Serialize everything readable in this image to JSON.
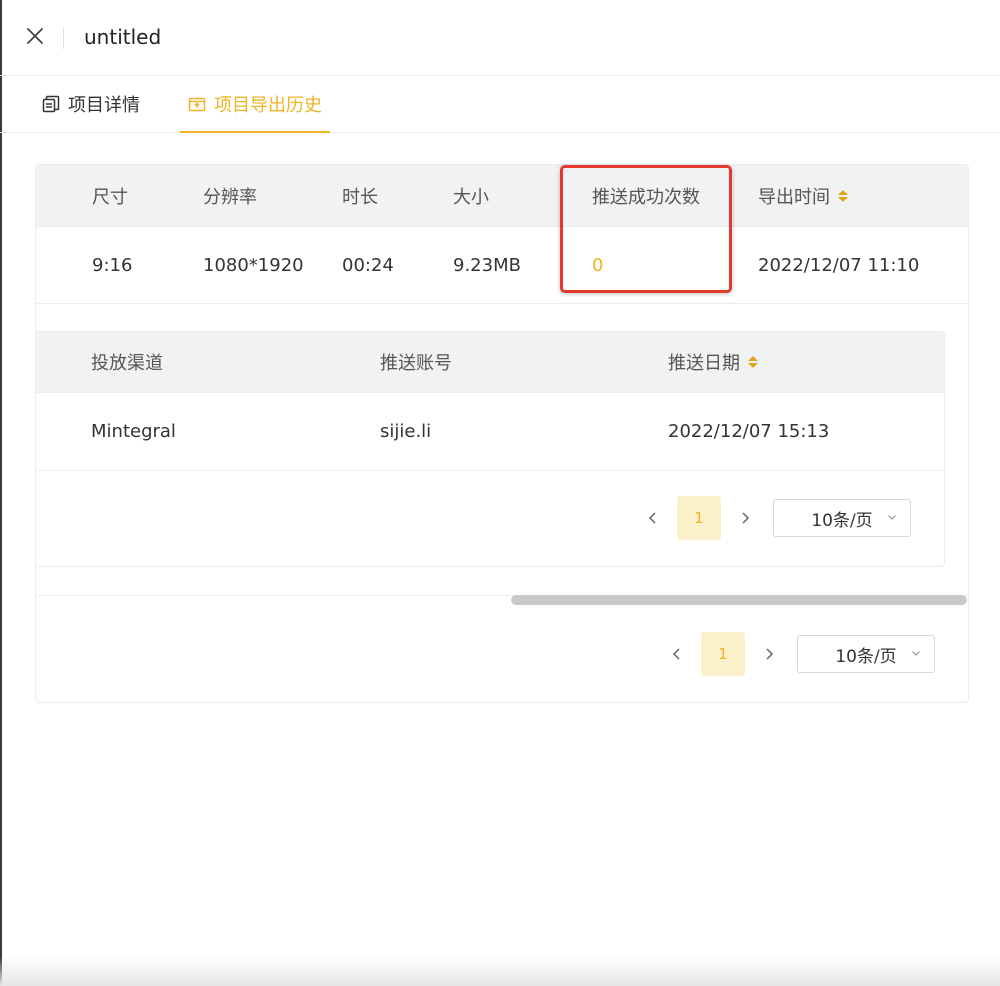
{
  "window": {
    "title": "untitled"
  },
  "tabs": [
    {
      "label": "项目详情",
      "icon": "copy-icon"
    },
    {
      "label": "项目导出历史",
      "icon": "export-icon",
      "active": true
    }
  ],
  "accent_color": "#f0b323",
  "highlight_color": "#e23b2e",
  "export_table": {
    "columns": [
      "尺寸",
      "分辨率",
      "时长",
      "大小",
      "推送成功次数",
      "导出时间"
    ],
    "rows": [
      {
        "size": "9:16",
        "resolution": "1080*1920",
        "duration": "00:24",
        "file_size": "9.23MB",
        "push_success_count": "0",
        "export_time": "2022/12/07 11:10"
      }
    ]
  },
  "push_table": {
    "columns": [
      "投放渠道",
      "推送账号",
      "推送日期"
    ],
    "rows": [
      {
        "channel": "Mintegral",
        "account": "sijie.li",
        "date": "2022/12/07 15:13"
      }
    ],
    "pagination": {
      "current_page": "1",
      "page_size": "10条/页"
    }
  },
  "outer_pagination": {
    "current_page": "1",
    "page_size": "10条/页"
  }
}
